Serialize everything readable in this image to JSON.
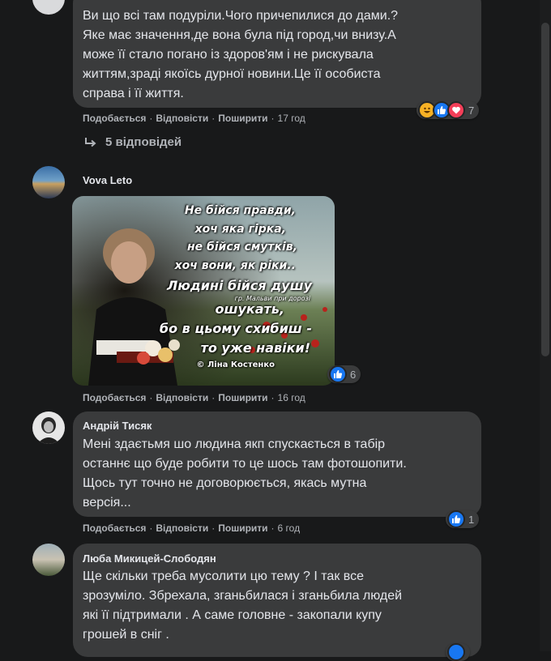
{
  "comments": [
    {
      "text": "Ви що всі там подуріли.Чого причепилися до дами.? Яке має значення,де вона була під город,чи внизу.А може її стало погано із здоров'ям і не рискувала життям,зраді якоїсь дурної новини.Це її особиста справа і її життя.",
      "lines": [
        "Ви що всі там подуріли.Чого причепилися до дами.?",
        "Яке має значення,де вона була під город,чи внизу.А",
        "може її стало погано із здоров'ям і не рискувала",
        "життям,зраді якоїсь дурної новини.Це її особиста",
        "справа і її життя."
      ],
      "actions": {
        "like": "Подобається",
        "reply": "Відповісти",
        "share": "Поширити",
        "time": "17 год"
      },
      "reaction_count": "7",
      "reactions": [
        "haha",
        "like",
        "love"
      ],
      "replies_label": "5 відповідей"
    },
    {
      "author": "Vova Leto",
      "image": {
        "lines": [
          "Не бійся правди,",
          "хоч яка гірка,",
          "не бійся смутків,",
          "хоч вони, як ріки..",
          "Людині бійся душу",
          "гр. Мальви при дорозі",
          "ошукать,",
          "бо в цьому схибиш -",
          "то уже навіки!",
          "© Ліна Костенко"
        ]
      },
      "actions": {
        "like": "Подобається",
        "reply": "Відповісти",
        "share": "Поширити",
        "time": "16 год"
      },
      "reaction_count": "6",
      "reactions": [
        "like"
      ]
    },
    {
      "author": "Андрій Тисяк",
      "text": "Мені здається шо людина якп спускається в табір останнє що буде робити то це шось там фотошопити. Щось тут точно не договорюється, якась мутна версія...",
      "lines": [
        "Мені здаєтьмя шо людина якп спускається в табір",
        "останнє що буде робити то це шось там фотошопити.",
        "Щось тут точно не договорюється, якась мутна",
        "версія..."
      ],
      "actions": {
        "like": "Подобається",
        "reply": "Відповісти",
        "share": "Поширити",
        "time": "6 год"
      },
      "reaction_count": "1",
      "reactions": [
        "like"
      ]
    },
    {
      "author": "Люба Микицей-Слободян",
      "lines": [
        "Ще скільки треба мусолити цю тему ? І так все",
        "зрозуміло. Збрехала, зганьбилася і зганьбила людей",
        "які її підтримали . А саме головне - закопали купу",
        "грошей в сніг ."
      ]
    }
  ],
  "colors": {
    "background": "#18191a",
    "bubble": "#3a3b3c",
    "text": "#e4e6eb",
    "secondary_text": "#b0b3b8",
    "like_blue": "#1877f2",
    "love_red": "#f33e58",
    "haha_yellow": "#f7b125"
  }
}
